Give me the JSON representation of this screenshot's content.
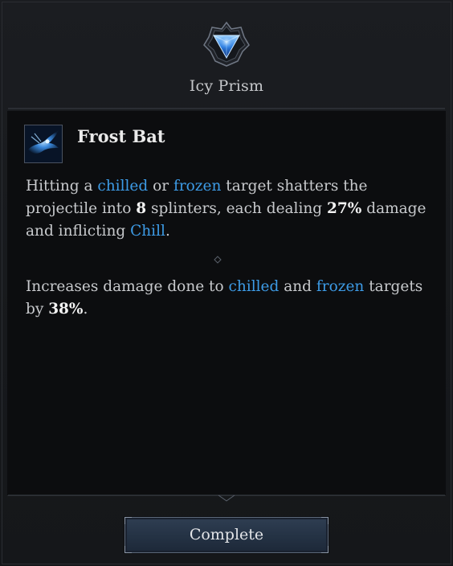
{
  "node": {
    "title": "Icy Prism",
    "emblem_icon": "blue-prism-gem-icon"
  },
  "skill": {
    "name": "Frost Bat",
    "icon": "frost-bat-icon"
  },
  "description1": {
    "t1": "Hitting a ",
    "k1": "chilled",
    "t2": " or ",
    "k2": "frozen",
    "t3": " target shatters the projectile into ",
    "n1": "8",
    "t4": " splinters, each dealing ",
    "n2": "27%",
    "t5": " damage and inflicting ",
    "k3": "Chill",
    "t6": "."
  },
  "description2": {
    "t1": "Increases damage done to ",
    "k1": "chilled",
    "t2": " and ",
    "k2": "frozen",
    "t3": " targets by ",
    "n1": "38%",
    "t4": "."
  },
  "button": {
    "label": "Complete"
  },
  "colors": {
    "keyword": "#3d9be6",
    "background": "#16181b",
    "content_bg": "#0c0d0f"
  }
}
